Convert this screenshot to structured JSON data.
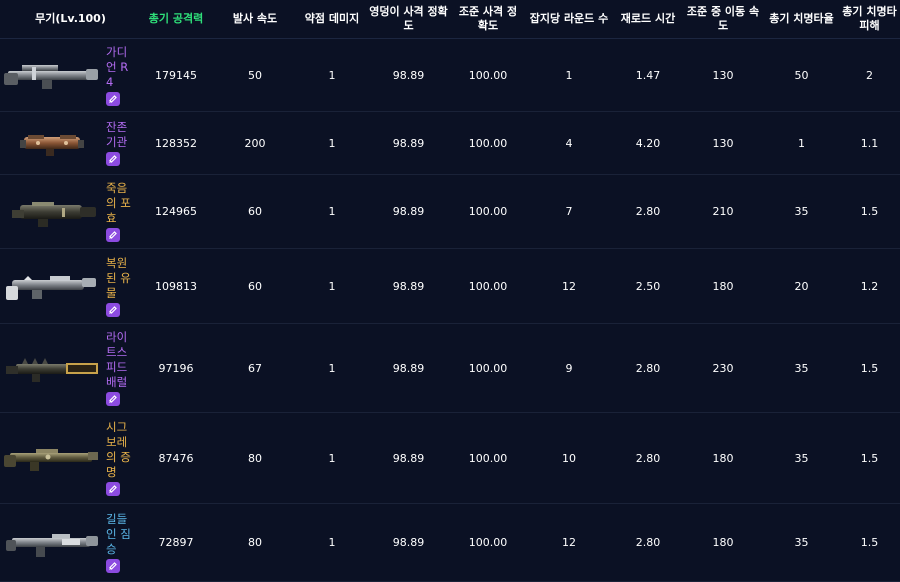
{
  "headers": [
    "무기(Lv.100)",
    "총기 공격력",
    "발사 속도",
    "약점 데미지",
    "영덩이 사격 정확도",
    "조준 사격 정확도",
    "잡지당 라운드 수",
    "재로드 시간",
    "조준 중 이동 속도",
    "총기 치명타율",
    "총기 치명타 피해"
  ],
  "colors": {
    "header_highlight": "#2fe07a",
    "rarity_purple": "#b36cf2",
    "rarity_gold": "#e9b34a",
    "rarity_blue": "#5bb7e8",
    "badge": "#8c4be0"
  },
  "rows": [
    {
      "name": "가디언 R4",
      "rarity": "purple",
      "icon": "heavy-gun-icon",
      "cells": [
        "179145",
        "50",
        "1",
        "98.89",
        "100.00",
        "1",
        "1.47",
        "130",
        "50",
        "2"
      ]
    },
    {
      "name": "잔존 기관",
      "rarity": "purple",
      "icon": "compact-gun-icon",
      "cells": [
        "128352",
        "200",
        "1",
        "98.89",
        "100.00",
        "4",
        "4.20",
        "130",
        "1",
        "1.1"
      ]
    },
    {
      "name": "죽음의 포효",
      "rarity": "gold",
      "icon": "launcher-gun-icon",
      "cells": [
        "124965",
        "60",
        "1",
        "98.89",
        "100.00",
        "7",
        "2.80",
        "210",
        "35",
        "1.5"
      ]
    },
    {
      "name": "복원된 유물",
      "rarity": "gold",
      "icon": "relic-gun-icon",
      "cells": [
        "109813",
        "60",
        "1",
        "98.89",
        "100.00",
        "12",
        "2.50",
        "180",
        "20",
        "1.2"
      ]
    },
    {
      "name": "라이트스피드 배럴",
      "rarity": "purple",
      "icon": "spiked-gun-icon",
      "cells": [
        "97196",
        "67",
        "1",
        "98.89",
        "100.00",
        "9",
        "2.80",
        "230",
        "35",
        "1.5"
      ]
    },
    {
      "name": "시그보레의 증명",
      "rarity": "gold",
      "icon": "long-gun-icon",
      "cells": [
        "87476",
        "80",
        "1",
        "98.89",
        "100.00",
        "10",
        "2.80",
        "180",
        "35",
        "1.5"
      ]
    },
    {
      "name": "길들인 짐승",
      "rarity": "blue",
      "icon": "beast-gun-icon",
      "cells": [
        "72897",
        "80",
        "1",
        "98.89",
        "100.00",
        "12",
        "2.80",
        "180",
        "35",
        "1.5"
      ]
    }
  ]
}
